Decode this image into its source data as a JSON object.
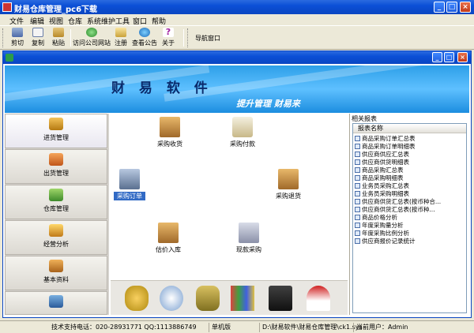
{
  "window": {
    "title": "财易仓库管理_pc6下载"
  },
  "menu": [
    "文件",
    "编辑",
    "视图",
    "仓库",
    "系统维护",
    "工具",
    "窗口",
    "帮助"
  ],
  "toolbar": {
    "buttons": [
      "剪切",
      "复制",
      "粘贴",
      "访问公司网站",
      "注册",
      "查看公告",
      "关于"
    ],
    "nav_window": "导航窗口"
  },
  "banner": {
    "brand": "财 易 软 件",
    "slogan": "提升管理  财易来"
  },
  "nav": [
    "进货管理",
    "出货管理",
    "仓库管理",
    "经营分析",
    "基本资料"
  ],
  "center_tiles": [
    "采购收货",
    "采购付款",
    "采购订单",
    "采购退货",
    "估价入库",
    "现款采购"
  ],
  "reports": {
    "heading": "相关报表",
    "column": "报表名称",
    "items": [
      "商品采购订单汇总表",
      "商品采购订单明细表",
      "供应商供应汇总表",
      "供应商供货明细表",
      "商品采购汇总表",
      "商品采购明细表",
      "业务员采购汇总表",
      "业务员采购明细表",
      "供应商供货汇总表(按币种合...",
      "供应商供货汇总表(按币种...",
      "商品价格分析",
      "年度采购量分析",
      "年度采购比例分析",
      "供应商报价记录统计"
    ]
  },
  "status": {
    "support": "技术支持电话：020-28931771 QQ:1113886749",
    "edition": "单机版",
    "path": "D:\\财易软件\\财易仓库管理\\ck1.sys",
    "user": "当前用户：Admin"
  },
  "colors": {
    "titlebar": "#0b4fd6",
    "banner": "#2d9fe8",
    "brand_text": "#0a2a6b"
  }
}
